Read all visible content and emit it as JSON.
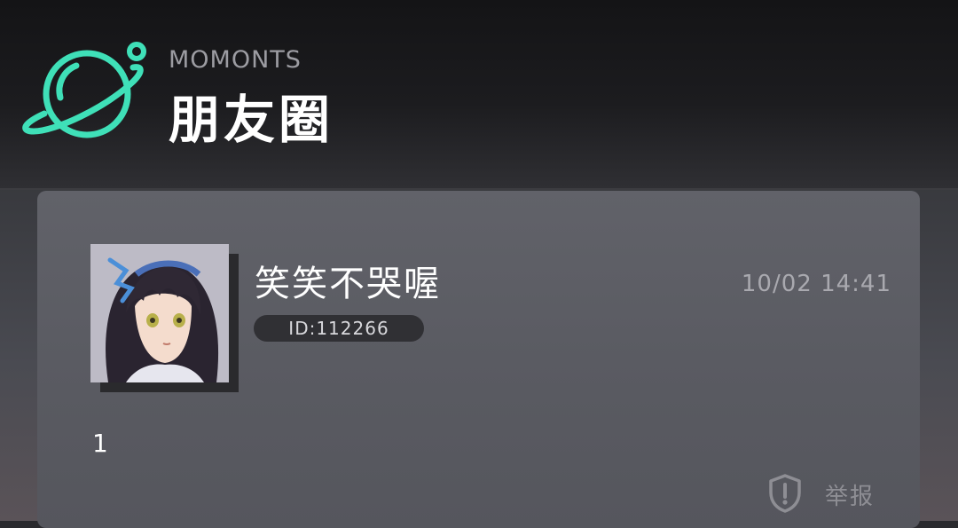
{
  "header": {
    "subtitle": "MOMONTS",
    "title": "朋友圈",
    "logo_icon": "planet-icon",
    "accent_color": "#3fe0b8"
  },
  "post": {
    "username": "笑笑不哭喔",
    "user_id": "ID:112266",
    "timestamp": "10/02 14:41",
    "content": "1",
    "avatar": "anime-girl-avatar",
    "report": {
      "icon": "shield-alert-icon",
      "label": "举报"
    }
  }
}
